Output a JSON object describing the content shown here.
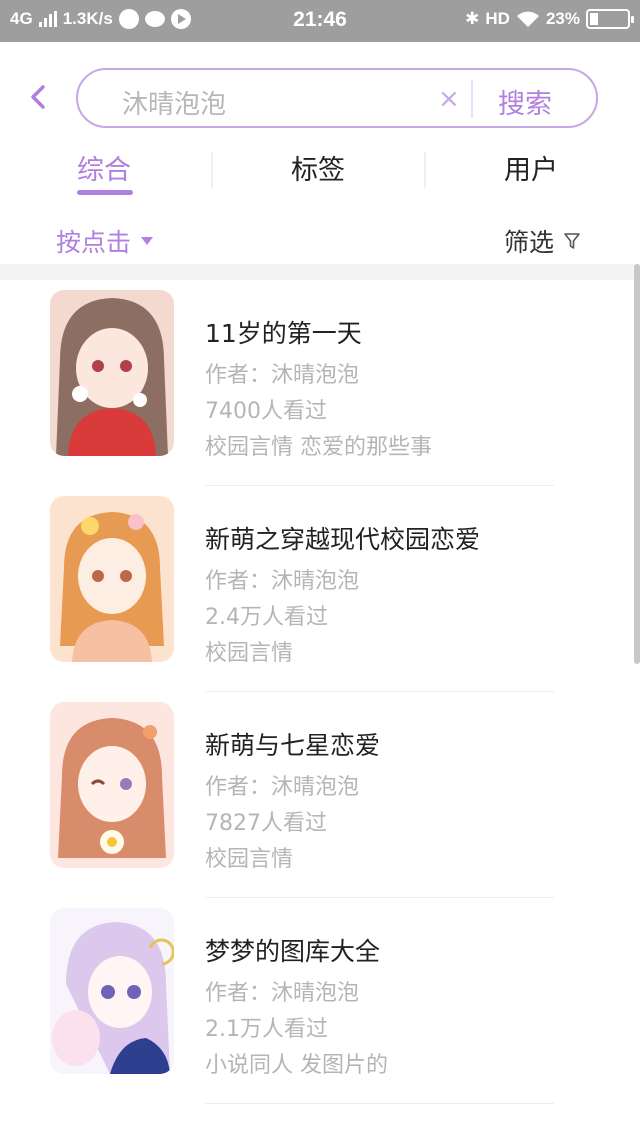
{
  "status_bar": {
    "network": "4G",
    "speed": "1.3K/s",
    "time": "21:46",
    "hd": "HD",
    "battery": "23%"
  },
  "search": {
    "query": "沐晴泡泡",
    "clear_label": "×",
    "button_label": "搜索"
  },
  "tabs": [
    {
      "label": "综合"
    },
    {
      "label": "标签"
    },
    {
      "label": "用户"
    }
  ],
  "sort": {
    "label": "按点击",
    "filter_label": "筛选"
  },
  "colors": {
    "accent": "#b07fe0",
    "accent_light": "#c5a8e6",
    "status_bar": "#9e9e9e"
  },
  "results": [
    {
      "title": "11岁的第一天",
      "author": "作者：沐晴泡泡",
      "views": "7400人看过",
      "tags": "校园言情 恋爱的那些事"
    },
    {
      "title": "新萌之穿越现代校园恋爱",
      "author": "作者：沐晴泡泡",
      "views": "2.4万人看过",
      "tags": "校园言情"
    },
    {
      "title": "新萌与七星恋爱",
      "author": "作者：沐晴泡泡",
      "views": "7827人看过",
      "tags": "校园言情"
    },
    {
      "title": "梦梦的图库大全",
      "author": "作者：沐晴泡泡",
      "views": "2.1万人看过",
      "tags": "小说同人 发图片的"
    }
  ]
}
